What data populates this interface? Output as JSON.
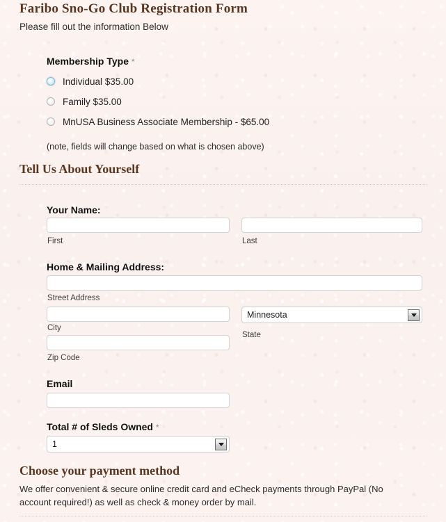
{
  "header": {
    "title": "Faribo Sno-Go Club Registration Form",
    "subtitle": "Please fill out the information Below"
  },
  "membership": {
    "label": "Membership Type",
    "required_marker": "*",
    "options": [
      {
        "label": "Individual $35.00",
        "selected": true
      },
      {
        "label": "Family $35.00",
        "selected": false
      },
      {
        "label": "MnUSA Business Associate Membership - $65.00",
        "selected": false
      }
    ],
    "note": "(note, fields will change based on what is chosen above)"
  },
  "about_section": {
    "heading": "Tell Us About Yourself",
    "name": {
      "label": "Your Name:",
      "first": {
        "value": "",
        "placeholder": "",
        "sub_label": "First"
      },
      "last": {
        "value": "",
        "placeholder": "",
        "sub_label": "Last"
      }
    },
    "address": {
      "label": "Home & Mailing Address:",
      "street": {
        "value": "",
        "placeholder": "",
        "sub_label": "Street Address"
      },
      "city": {
        "value": "",
        "placeholder": "",
        "sub_label": "City"
      },
      "state": {
        "value": "Minnesota",
        "sub_label": "State",
        "arrow_icon": "chevron-down-icon"
      },
      "zip": {
        "value": "",
        "placeholder": "",
        "sub_label": "Zip Code"
      }
    },
    "email": {
      "label": "Email",
      "value": "",
      "placeholder": ""
    },
    "sleds": {
      "label": "Total # of Sleds Owned",
      "required_marker": "*",
      "value": "1",
      "arrow_icon": "chevron-down-icon"
    }
  },
  "payment_section": {
    "heading": "Choose your payment method",
    "description": "We offer convenient & secure online credit card and eCheck payments through PayPal (No account required!) as well as check & money order by mail."
  },
  "colors": {
    "page_background": "#fbf1ee",
    "heading_brown": "#5a3520",
    "body_text": "#222222",
    "input_border": "#d2d2d2",
    "divider": "#d9c6c0",
    "radio_focus_blue": "#7fb7d6"
  }
}
